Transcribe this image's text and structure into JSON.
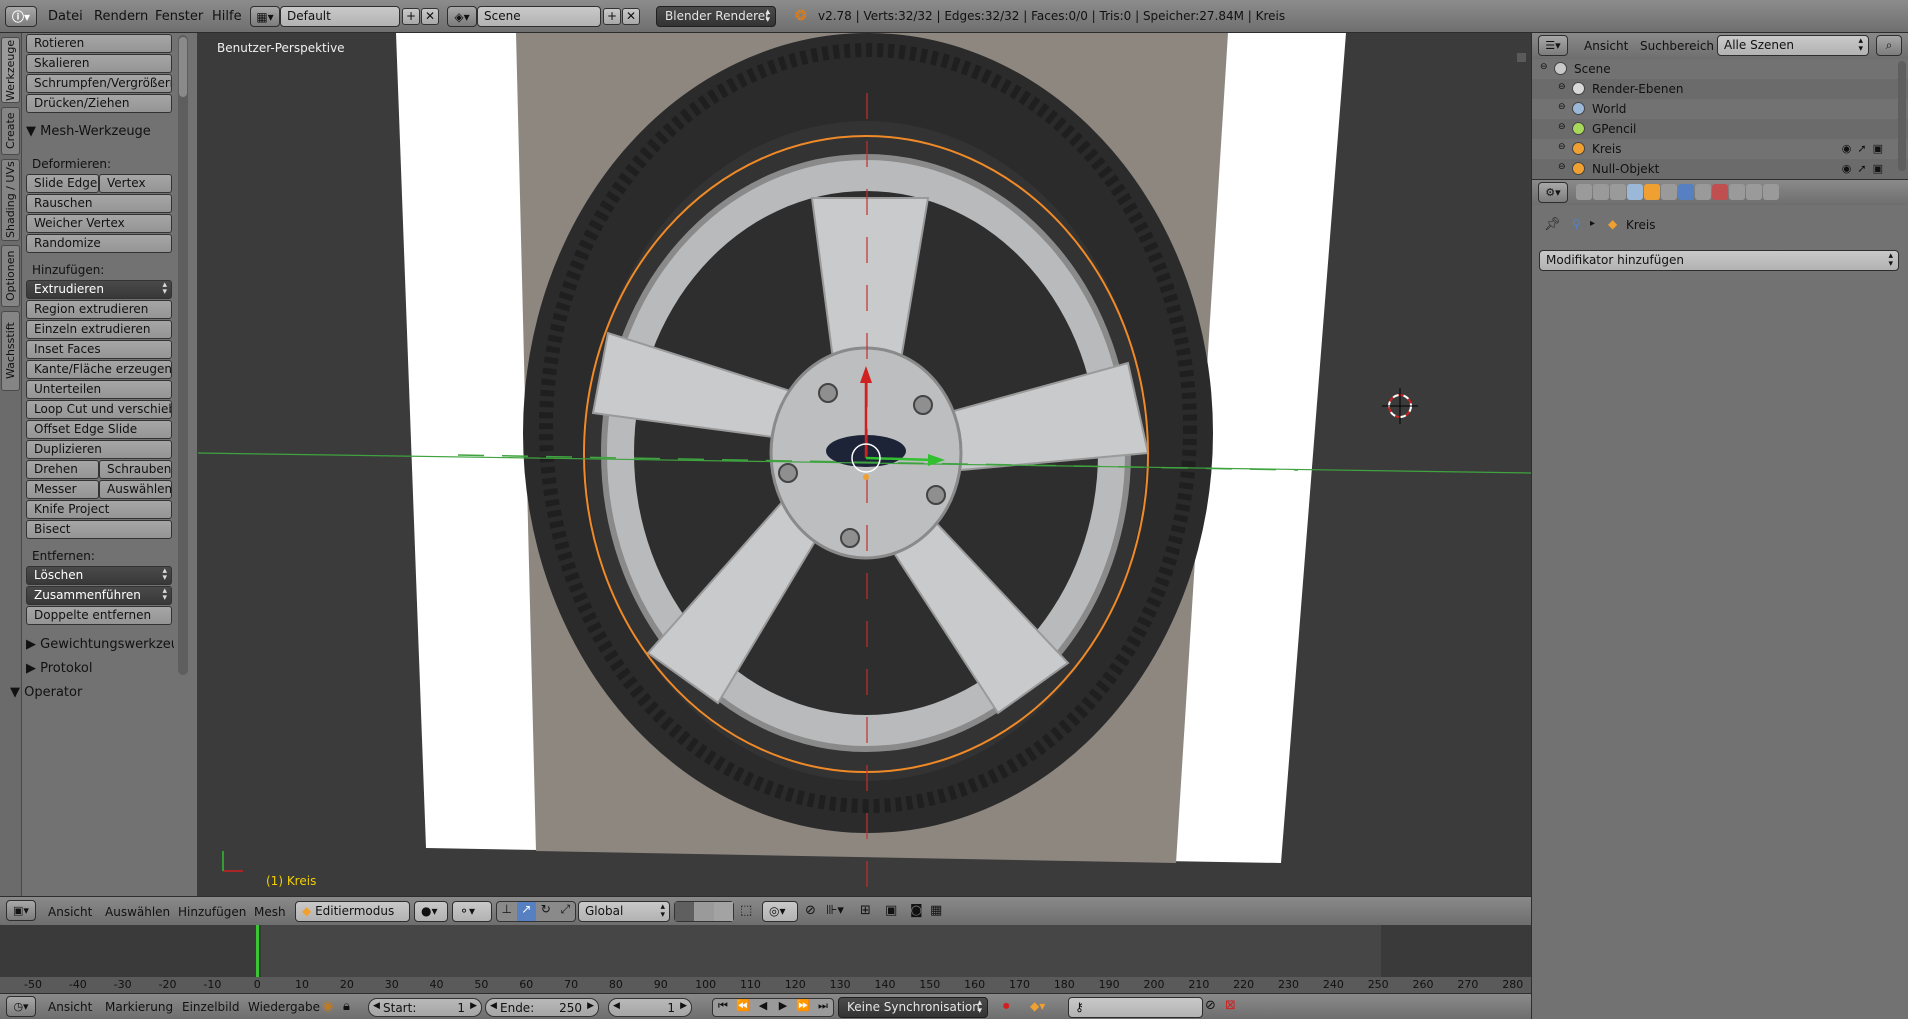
{
  "topbar": {
    "menus": [
      "Datei",
      "Rendern",
      "Fenster",
      "Hilfe"
    ],
    "screen_layout": "Default",
    "scene": "Scene",
    "render_engine": "Blender Renderer",
    "stats": "v2.78 | Verts:32/32 | Edges:32/32 | Faces:0/0 | Tris:0 | Speicher:27.84M | Kreis"
  },
  "left_tabs": [
    "Werkzeuge",
    "Create",
    "Shading / UVs",
    "Optionen",
    "Wachsstift"
  ],
  "toolshelf": {
    "transform_buttons": [
      "Rotieren",
      "Skalieren",
      "Schrumpfen/Vergrößern",
      "Drücken/Ziehen"
    ],
    "mesh_panel_title": "Mesh-Werkzeuge",
    "deform_label": "Deformieren:",
    "slide_edge": "Slide Edge",
    "vertex": "Vertex",
    "deform_buttons": [
      "Rauschen",
      "Weicher Vertex",
      "Randomize"
    ],
    "add_label": "Hinzufügen:",
    "extrude": "Extrudieren",
    "add_buttons": [
      "Region extrudieren",
      "Einzeln extrudieren",
      "Inset Faces",
      "Kante/Fläche erzeugen",
      "Unterteilen",
      "Loop Cut und verschieben",
      "Offset Edge Slide",
      "Duplizieren"
    ],
    "drehen": "Drehen",
    "schrauben": "Schrauben",
    "messer": "Messer",
    "auswaehlen": "Auswählen",
    "knife_project": "Knife Project",
    "bisect": "Bisect",
    "remove_label": "Entfernen:",
    "loeschen": "Löschen",
    "zusammenfuehren": "Zusammenführen",
    "doppelte": "Doppelte entfernen",
    "weights_panel": "Gewichtungswerkzeug",
    "history_panel": "Protokol",
    "operator_panel": "Operator"
  },
  "viewport": {
    "title": "Benutzer-Perspektive",
    "object_label": "(1) Kreis"
  },
  "view3d_header": {
    "menus": [
      "Ansicht",
      "Auswählen",
      "Hinzufügen",
      "Mesh"
    ],
    "mode": "Editiermodus",
    "orientation": "Global"
  },
  "timeline": {
    "ticks": [
      -50,
      -40,
      -30,
      -20,
      -10,
      0,
      10,
      20,
      30,
      40,
      50,
      60,
      70,
      80,
      90,
      100,
      110,
      120,
      130,
      140,
      150,
      160,
      170,
      180,
      190,
      200,
      210,
      220,
      230,
      240,
      250,
      260,
      270,
      280
    ],
    "current_frame_value": 0,
    "menus": [
      "Ansicht",
      "Markierung",
      "Einzelbild",
      "Wiedergabe"
    ],
    "start_label": "Start:",
    "start_value": "1",
    "end_label": "Ende:",
    "end_value": "250",
    "current_frame": "1",
    "sync": "Keine Synchronisation"
  },
  "outliner": {
    "menus": [
      "Ansicht",
      "Suchbereich"
    ],
    "filter": "Alle Szenen",
    "items": [
      {
        "label": "Scene",
        "indent": 0,
        "color": "#c9c9c9"
      },
      {
        "label": "Render-Ebenen",
        "indent": 1,
        "color": "#d8d8d8"
      },
      {
        "label": "World",
        "indent": 1,
        "color": "#9cb8d8"
      },
      {
        "label": "GPencil",
        "indent": 1,
        "color": "#a7d85a"
      },
      {
        "label": "Kreis",
        "indent": 1,
        "color": "#f0a030"
      },
      {
        "label": "Null-Objekt",
        "indent": 1,
        "color": "#f0a030"
      }
    ]
  },
  "properties": {
    "object_name": "Kreis",
    "add_modifier": "Modifikator hinzufügen"
  },
  "colors": {
    "accent_blue": "#5680c2",
    "axis_green": "#3fa33f",
    "axis_red": "#c23030",
    "mesh_orange": "#f08a28"
  }
}
